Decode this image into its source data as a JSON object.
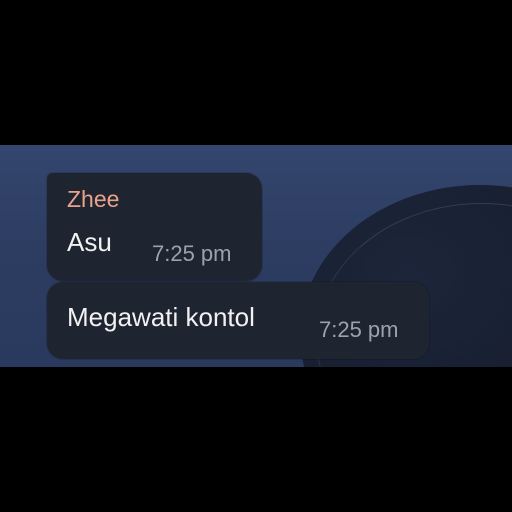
{
  "messages": [
    {
      "sender": "Zhee",
      "text": "Asu",
      "time": "7:25 pm"
    },
    {
      "text": "Megawati kontol",
      "time": "7:25 pm"
    }
  ],
  "colors": {
    "sender_name": "#e9a38a",
    "bubble_bg": "#1f2530",
    "chat_bg": "#2d3d62",
    "time_text": "#9aa2ae"
  }
}
